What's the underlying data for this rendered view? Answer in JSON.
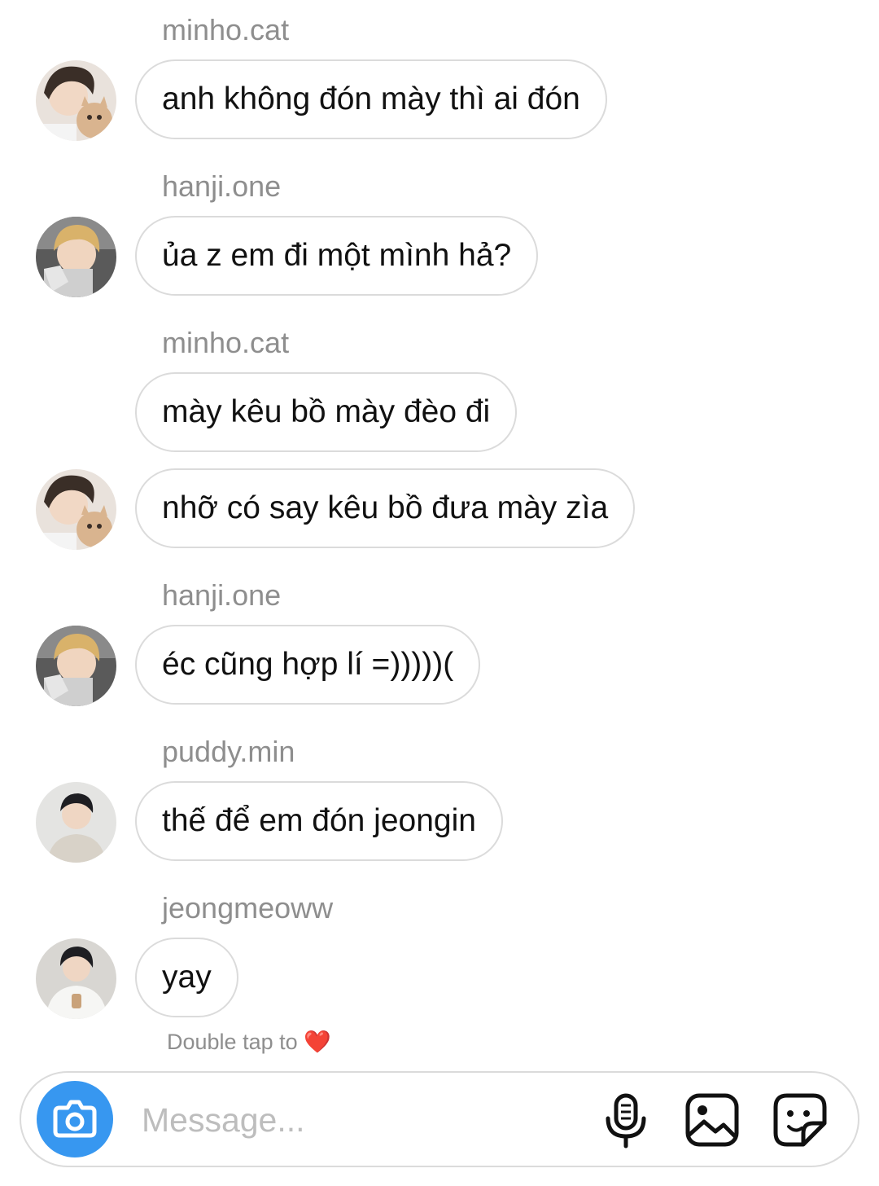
{
  "thread": {
    "messages": [
      {
        "sender": "minho.cat",
        "text": "anh không đón mày thì ai đón"
      },
      {
        "sender": "hanji.one",
        "text": "ủa z em đi một mình hả?"
      },
      {
        "sender": "minho.cat",
        "text": "mày kêu bồ mày đèo đi"
      },
      {
        "sender": "",
        "text": "nhỡ có say kêu bồ đưa mày zìa"
      },
      {
        "sender": "hanji.one",
        "text": "éc cũng hợp lí =)))))("
      },
      {
        "sender": "puddy.min",
        "text": "thế để em đón jeongin"
      },
      {
        "sender": "jeongmeoww",
        "text": "yay"
      }
    ],
    "double_tap_hint": "Double tap to",
    "double_tap_heart": "❤️"
  },
  "composer": {
    "placeholder": "Message...",
    "camera_icon": "camera-icon",
    "mic_icon": "microphone-icon",
    "gallery_icon": "image-icon",
    "sticker_icon": "sticker-icon",
    "accent_color": "#3797f0"
  }
}
